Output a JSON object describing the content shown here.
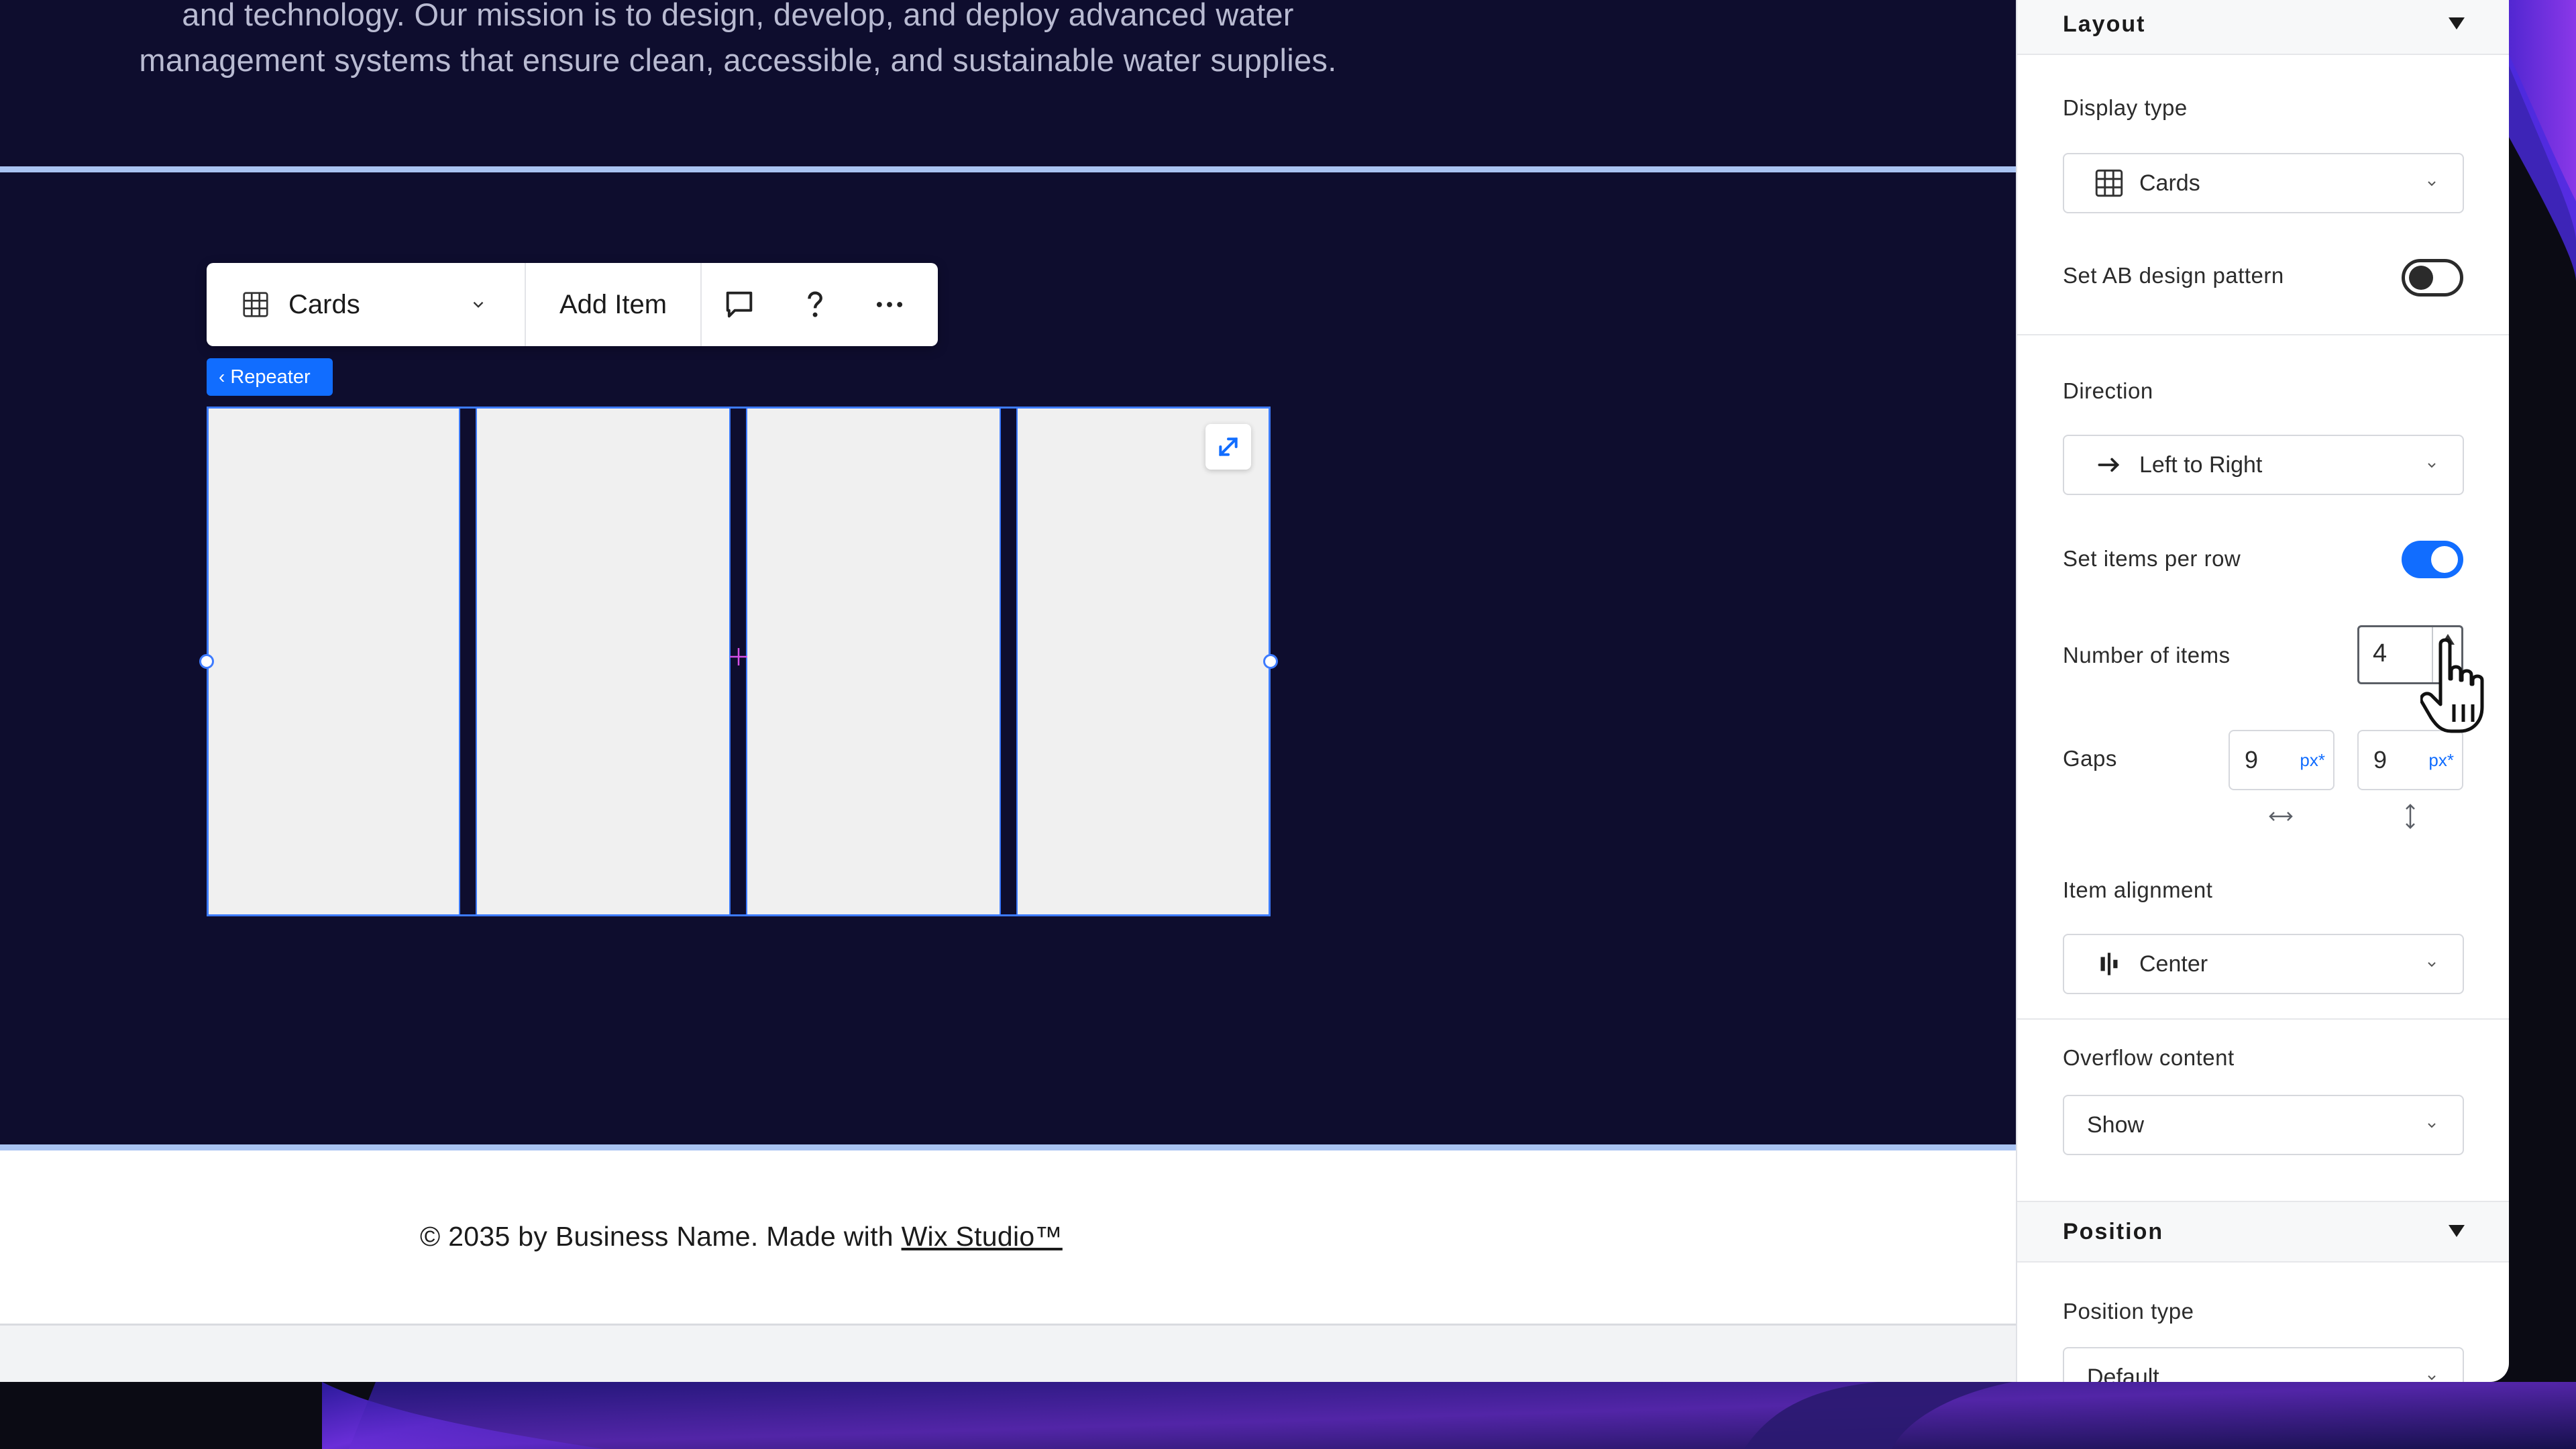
{
  "site": {
    "hero_line1": "and technology. Our mission is to design, develop, and deploy advanced water",
    "hero_line2": "management systems that ensure clean, accessible, and sustainable water supplies.",
    "footer_prefix": "© 2035 by Business Name. Made with ",
    "footer_link": "Wix Studio™"
  },
  "toolbar": {
    "layout_label": "Cards",
    "add_item_label": "Add Item"
  },
  "repeater": {
    "tag_label": "Repeater",
    "items_per_row": 4
  },
  "panel": {
    "layout_header": "Layout",
    "display_type_label": "Display type",
    "display_type_value": "Cards",
    "ab_pattern_label": "Set AB design pattern",
    "ab_pattern_on": false,
    "direction_label": "Direction",
    "direction_value": "Left to Right",
    "items_per_row_label": "Set items per row",
    "items_per_row_on": true,
    "number_of_items_label": "Number of items",
    "number_of_items_value": "4",
    "gaps_label": "Gaps",
    "gap_horizontal": "9",
    "gap_vertical": "9",
    "gap_unit": "px*",
    "item_alignment_label": "Item alignment",
    "item_alignment_value": "Center",
    "overflow_label": "Overflow content",
    "overflow_value": "Show",
    "position_header": "Position",
    "position_type_label": "Position type",
    "position_type_value": "Default"
  },
  "colors": {
    "accent": "#116dff",
    "canvas_bg": "#0e0d2e",
    "card_bg": "#f0f0f0"
  }
}
